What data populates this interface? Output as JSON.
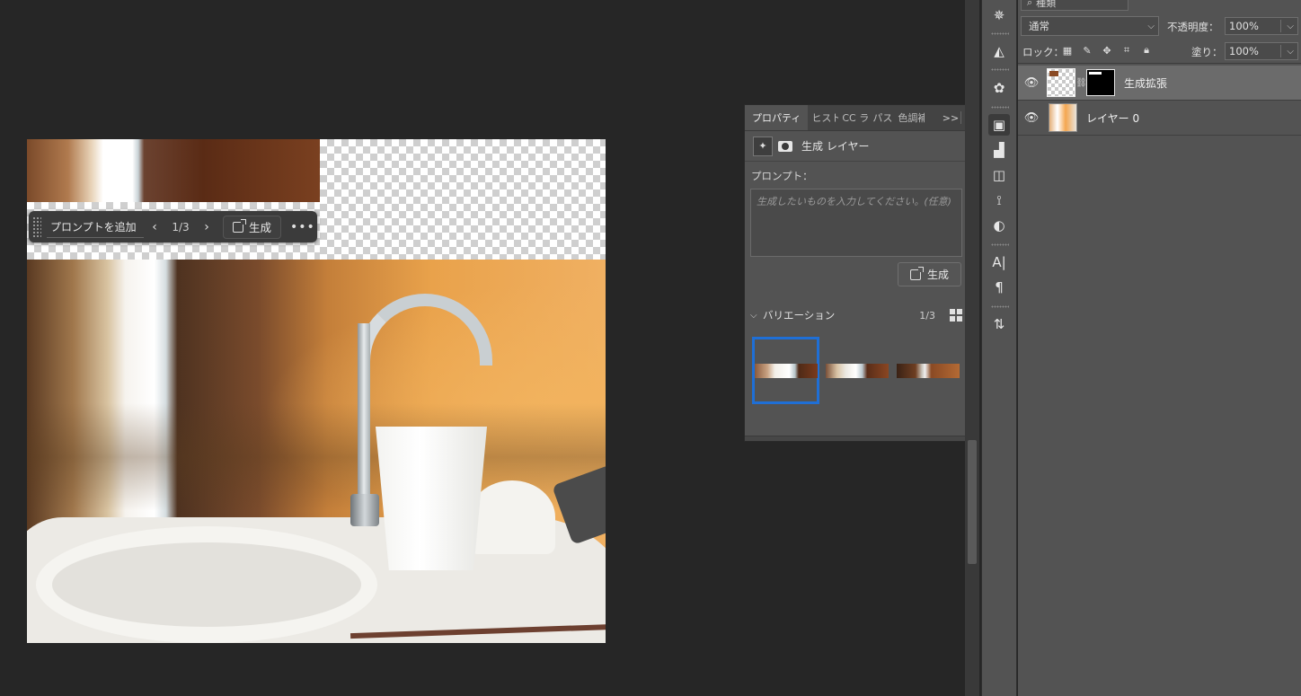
{
  "canvas": {
    "taskbar": {
      "prompt_label": "プロンプトを追加",
      "prev_icon": "chevron-left",
      "variation_count": "1/3",
      "next_icon": "chevron-right",
      "generate_label": "生成",
      "more_icon": "more-horizontal"
    }
  },
  "properties_panel": {
    "tabs": [
      {
        "label": "プロパティ",
        "active": true
      },
      {
        "label": "ヒストリ"
      },
      {
        "label": "CC ライ"
      },
      {
        "label": "パス"
      },
      {
        "label": "色調補"
      }
    ],
    "more_tabs_label": ">>",
    "layer_type_label": "生成 レイヤー",
    "prompt_heading": "プロンプト：",
    "prompt_placeholder": "生成したいものを入力してください。(任意)",
    "generate_label": "生成",
    "variations_label": "バリエーション",
    "variations_count": "1/3",
    "selected_variation": 1
  },
  "layers_panel": {
    "filter_label": "種類",
    "blend_mode": "通常",
    "opacity_label": "不透明度：",
    "opacity_value": "100%",
    "lock_label": "ロック：",
    "fill_label": "塗り：",
    "fill_value": "100%",
    "layers": [
      {
        "name": "生成拡張",
        "selected": true
      },
      {
        "name": "レイヤー 0",
        "selected": false
      }
    ]
  },
  "dock_icons": [
    "compass-icon",
    "3d-icon",
    "color-circles-icon",
    "layer-comps-icon",
    "histogram-icon",
    "library-icon",
    "pen-path-icon",
    "adjustment-icon",
    "character-icon",
    "paragraph-icon",
    "glyph-swap-icon"
  ],
  "colors": {
    "app_bg": "#262626",
    "panel_bg": "#535353",
    "selection_blue": "#1f6fd6"
  }
}
